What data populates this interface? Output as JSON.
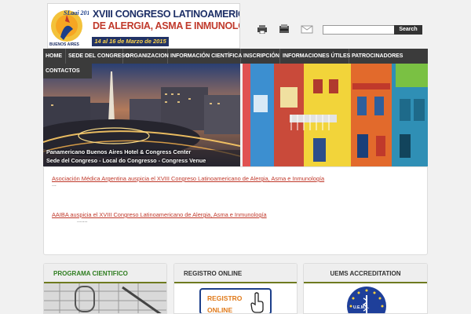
{
  "header": {
    "logo": {
      "brand": "SLaai 2015",
      "city": "BUENOS AIRES",
      "line1": "XVIII CONGRESO LATINOAMERICANO",
      "line2": "DE ALERGIA, ASMA E INMUNOLOGÍA",
      "dates": "14 al 16 de Marzo de 2015"
    },
    "tools": [
      "print-icon",
      "pdf-icon",
      "email-icon"
    ],
    "search": {
      "value": "",
      "button_label": "Search"
    }
  },
  "nav": {
    "items": [
      "HOME",
      "SEDE DEL CONGRESO",
      "ORGANIZACION",
      "INFORMACIÓN CIENTÍFICA",
      "INSCRIPCIÓN",
      "INFORMACIONES ÚTILES",
      "PATROCINADORES",
      "CONTACTOS"
    ]
  },
  "slideshow": {
    "caption_line1": "Panamericano Buenos Aires Hotel & Congress Center",
    "caption_line2": "Sede del Congreso - Local do Congresso - Congress Venue"
  },
  "news": {
    "items": [
      {
        "title": "Asociación Médica Argentina auspicia el XVIII Congreso Latinoamericano de Alergia, Asma e Inmunología",
        "more": "..."
      },
      {
        "title": "AAIBA auspicia el XVIII Congreso Latinoamericano de Alergia, Asma e Inmunología",
        "more": "......."
      }
    ]
  },
  "boxes": [
    {
      "title": "PROGRAMA CIENTIFICO",
      "title_color": "#2e7d1f"
    },
    {
      "title": "REGISTRO ONLINE",
      "title_color": "#333333",
      "button_line1": "REGISTRO",
      "button_line2": "ONLINE"
    },
    {
      "title": "UEMS ACCREDITATION",
      "title_color": "#333333",
      "badge_text": "U.E.M.S."
    }
  ],
  "colors": {
    "nav_bg": "#3b3b3b",
    "link": "#c0392b",
    "accent_green": "#6e7a1f"
  }
}
